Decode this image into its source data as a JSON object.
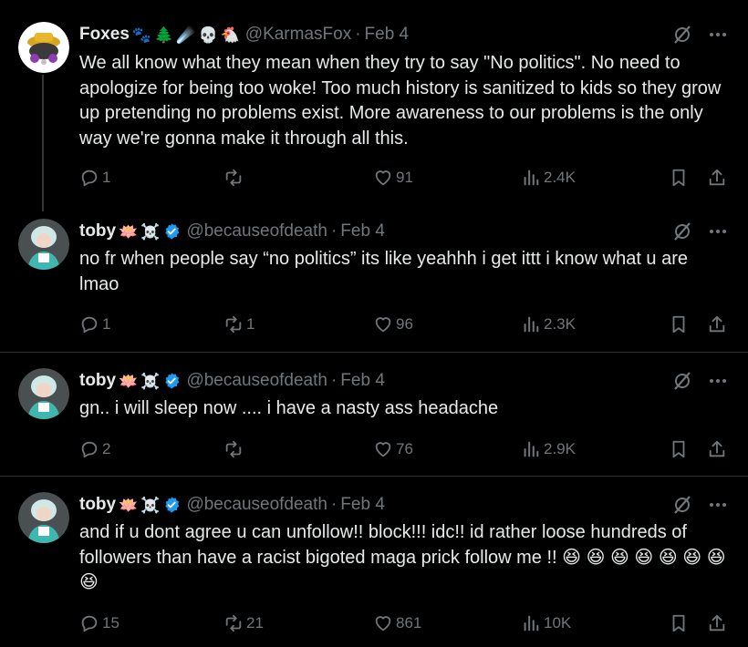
{
  "tweets": [
    {
      "name": "Foxes",
      "name_emojis": [
        "🐾",
        "🌲",
        "☄️",
        "💀",
        "🐔"
      ],
      "handle": "@KarmasFox",
      "date": "Feb 4",
      "verified": false,
      "text": "We all know what they mean when they try to say \"No politics\". No need to apologize for being too woke! Too much history is sanitized to kids so they grow up pretending no problems exist. More awareness to our problems is the only way we're gonna make it through all this.",
      "replies": "1",
      "reposts": "",
      "likes": "91",
      "views": "2.4K"
    },
    {
      "name": "toby",
      "name_emojis": [
        "🪷",
        "☠️"
      ],
      "handle": "@becauseofdeath",
      "date": "Feb 4",
      "verified": true,
      "text": "no fr when people say “no politics” its like yeahhh i get ittt i know what u are lmao",
      "replies": "1",
      "reposts": "1",
      "likes": "96",
      "views": "2.3K"
    },
    {
      "name": "toby",
      "name_emojis": [
        "🪷",
        "☠️"
      ],
      "handle": "@becauseofdeath",
      "date": "Feb 4",
      "verified": true,
      "text": "gn.. i will sleep now .... i have a nasty ass headache",
      "replies": "2",
      "reposts": "",
      "likes": "76",
      "views": "2.9K"
    },
    {
      "name": "toby",
      "name_emojis": [
        "🪷",
        "☠️"
      ],
      "handle": "@becauseofdeath",
      "date": "Feb 4",
      "verified": true,
      "text": "and if u dont agree u can unfollow!! block!!! idc!! id rather loose hundreds of followers than have a racist bigoted maga prick follow me !!",
      "trailing_emojis": [
        "😆",
        "😆",
        "😆",
        "😆",
        "😆",
        "😆",
        "😆",
        "😆"
      ],
      "replies": "15",
      "reposts": "21",
      "likes": "861",
      "views": "10K"
    }
  ],
  "icons": [
    "reply-icon",
    "repost-icon",
    "like-icon",
    "views-icon",
    "bookmark-icon",
    "share-icon",
    "grok-icon",
    "more-icon",
    "verified-icon"
  ],
  "colors": {
    "background": "#000000",
    "text": "#e7e9ea",
    "muted": "#71767b",
    "separator": "#2f3336",
    "verified": "#1d9bf0"
  }
}
